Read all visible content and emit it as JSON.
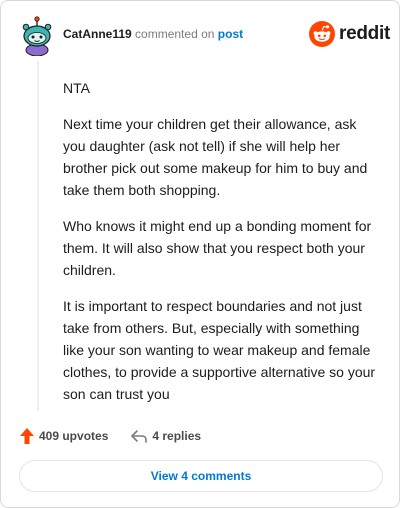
{
  "header": {
    "username": "CatAnne119",
    "action_text": "commented on",
    "post_link": "post",
    "brand": "reddit"
  },
  "comment": {
    "paragraphs": [
      "NTA",
      "Next time your children get their allowance, ask you daughter (ask not tell) if she will help her brother pick out some makeup for him to buy and take them both shopping.",
      "Who knows it might end up a bonding moment for them. It will also show that you respect both your children.",
      "It is important to respect boundaries and not just take from others. But, especially with something like your son wanting to wear makeup and female clothes, to provide a supportive alternative so your son can trust you"
    ]
  },
  "actions": {
    "upvotes": "409 upvotes",
    "replies": "4 replies",
    "view_comments": "View 4 comments"
  },
  "colors": {
    "brand_orange": "#ff4500",
    "link_blue": "#0079d3",
    "avatar_teal": "#3fb4b2"
  },
  "icons": {
    "brand": "reddit-snoo-icon",
    "upvote": "upvote-arrow-icon",
    "reply": "reply-arrow-icon"
  }
}
